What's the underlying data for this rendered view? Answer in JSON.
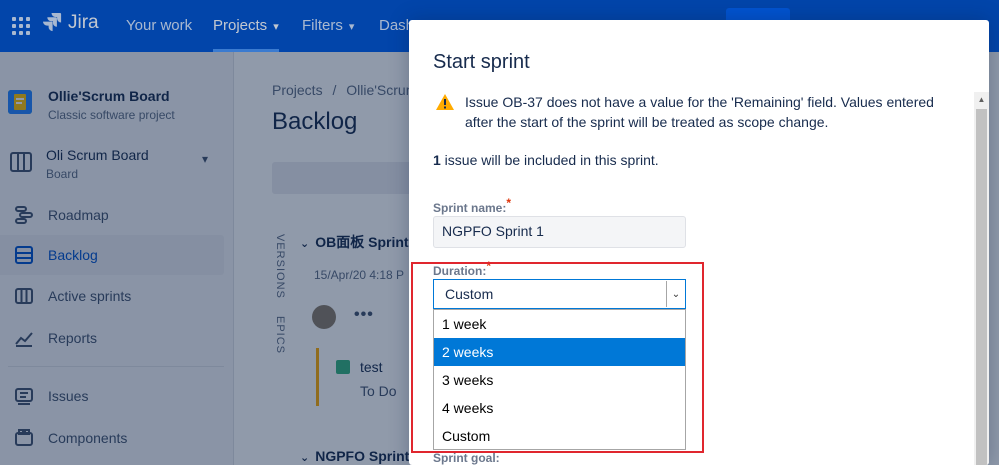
{
  "nav": {
    "product": "Jira",
    "items": [
      "Your work",
      "Projects",
      "Filters",
      "Dash"
    ],
    "active": "Projects"
  },
  "sidebar": {
    "project_name": "Ollie'Scrum Board",
    "project_type": "Classic software project",
    "board_name": "Oli Scrum Board",
    "board_sub": "Board",
    "items": [
      {
        "label": "Roadmap",
        "icon": "roadmap-icon"
      },
      {
        "label": "Backlog",
        "icon": "backlog-icon"
      },
      {
        "label": "Active sprints",
        "icon": "active-sprints-icon"
      },
      {
        "label": "Reports",
        "icon": "reports-icon"
      },
      {
        "label": "Issues",
        "icon": "issues-icon"
      },
      {
        "label": "Components",
        "icon": "components-icon"
      }
    ],
    "active": "Backlog"
  },
  "main": {
    "breadcrumb_projects": "Projects",
    "breadcrumb_sep": "/",
    "breadcrumb_board": "Ollie'Scrum",
    "title": "Backlog",
    "vtab_versions": "VERSIONS",
    "vtab_epics": "EPICS",
    "sprint1_title": "OB面板 Sprint",
    "sprint1_date": "15/Apr/20 4:18 P",
    "issue_title": "test",
    "issue_status": "To Do",
    "sprint2_title": "NGPFO Sprint"
  },
  "modal": {
    "title": "Start sprint",
    "warning": "Issue OB-37 does not have a value for the 'Remaining' field. Values entered after the start of the sprint will be treated as scope change.",
    "count_num": "1",
    "count_text": " issue will be included in this sprint.",
    "sprint_name_label": "Sprint name:",
    "sprint_name_value": "NGPFO Sprint 1",
    "duration_label": "Duration:",
    "duration_value": "Custom",
    "duration_options": [
      "1 week",
      "2 weeks",
      "3 weeks",
      "4 weeks",
      "Custom"
    ],
    "highlighted_option": "2 weeks",
    "sprint_goal_label": "Sprint goal:",
    "required_mark": "*"
  },
  "colors": {
    "nav_bg": "#0052CC",
    "highlight_border": "#E0262E",
    "selected_option": "#0078D7",
    "warning": "#FFAB00"
  }
}
